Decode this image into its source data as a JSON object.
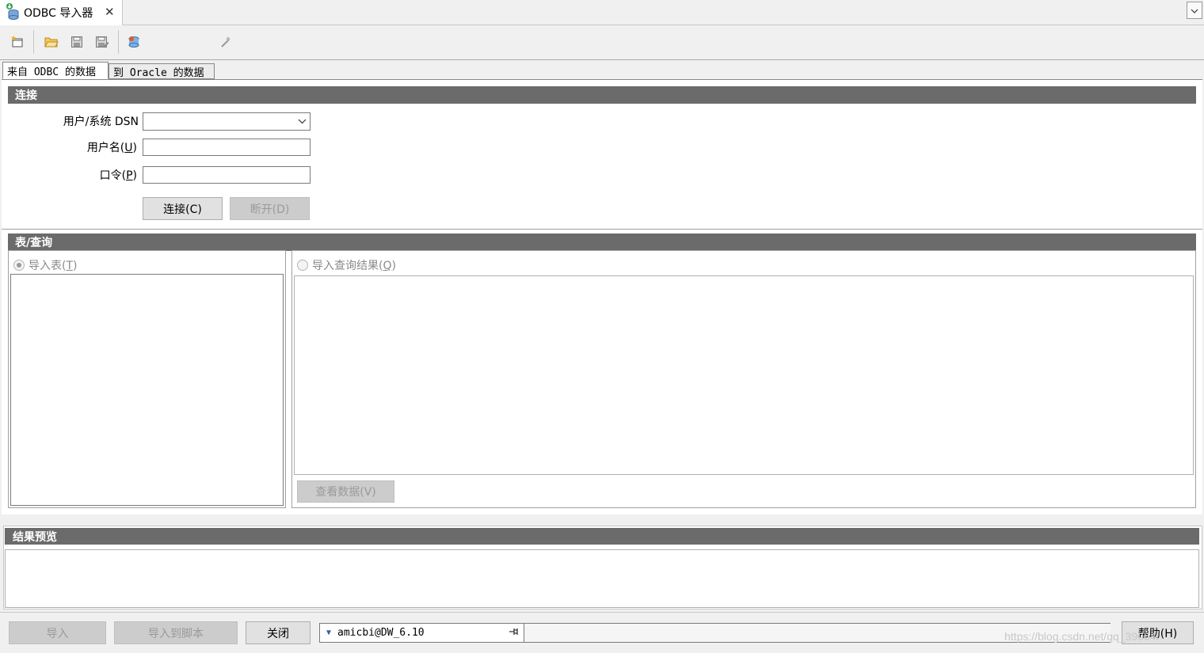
{
  "window": {
    "tab_title": "ODBC 导入器",
    "close_glyph": "✕",
    "dropdown_glyph": "⌄"
  },
  "toolbar": {
    "icons": [
      "new-window-icon",
      "open-folder-icon",
      "save-icon",
      "save-as-icon",
      "database-connect-icon",
      "wand-icon"
    ]
  },
  "subtabs": {
    "from_odbc": "来自 ODBC 的数据",
    "to_oracle": "到 Oracle 的数据"
  },
  "connection": {
    "header": "连接",
    "dsn_label": "用户/系统 DSN",
    "dsn_value": "",
    "username_label_prefix": "用户名(",
    "username_mnemonic": "U",
    "username_label_suffix": ")",
    "username_value": "",
    "password_label_prefix": "口令(",
    "password_mnemonic": "P",
    "password_label_suffix": ")",
    "password_value": "",
    "connect_button": "连接(C)",
    "disconnect_button": "断开(D)"
  },
  "table_query": {
    "header": "表/查询",
    "import_table_prefix": "导入表(",
    "import_table_mnemonic": "T",
    "import_table_suffix": ")",
    "import_query_prefix": "导入查询结果(",
    "import_query_mnemonic": "Q",
    "import_query_suffix": ")",
    "view_data_button": "查看数据(V)"
  },
  "preview": {
    "header": "结果预览"
  },
  "bottom": {
    "import_button": "导入",
    "import_to_script_button": "导入到脚本",
    "close_button": "关闭",
    "connection_value": "amicbi@DW_6.10",
    "help_button": "帮助(H)",
    "watermark": "https://blog.csdn.net/qq_39064l"
  },
  "colors": {
    "section_header_bg": "#6b6b6b",
    "panel_bg": "#ffffff",
    "window_bg": "#f0f0f0"
  }
}
